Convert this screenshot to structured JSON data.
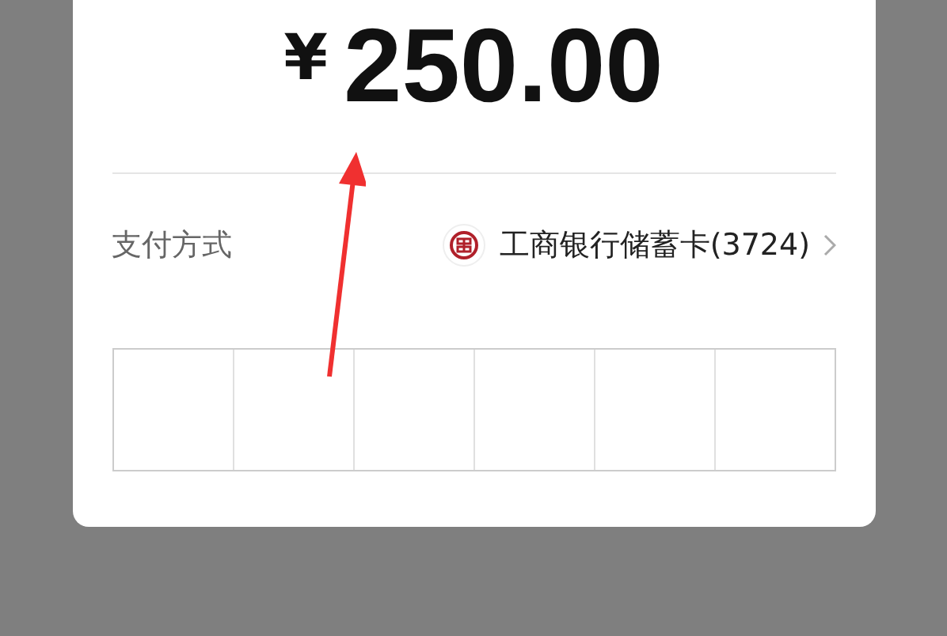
{
  "payment_dialog": {
    "amount": {
      "currency": "¥",
      "value": "250.00"
    },
    "method_label": "支付方式",
    "method_value": "工商银行储蓄卡(3724)"
  }
}
